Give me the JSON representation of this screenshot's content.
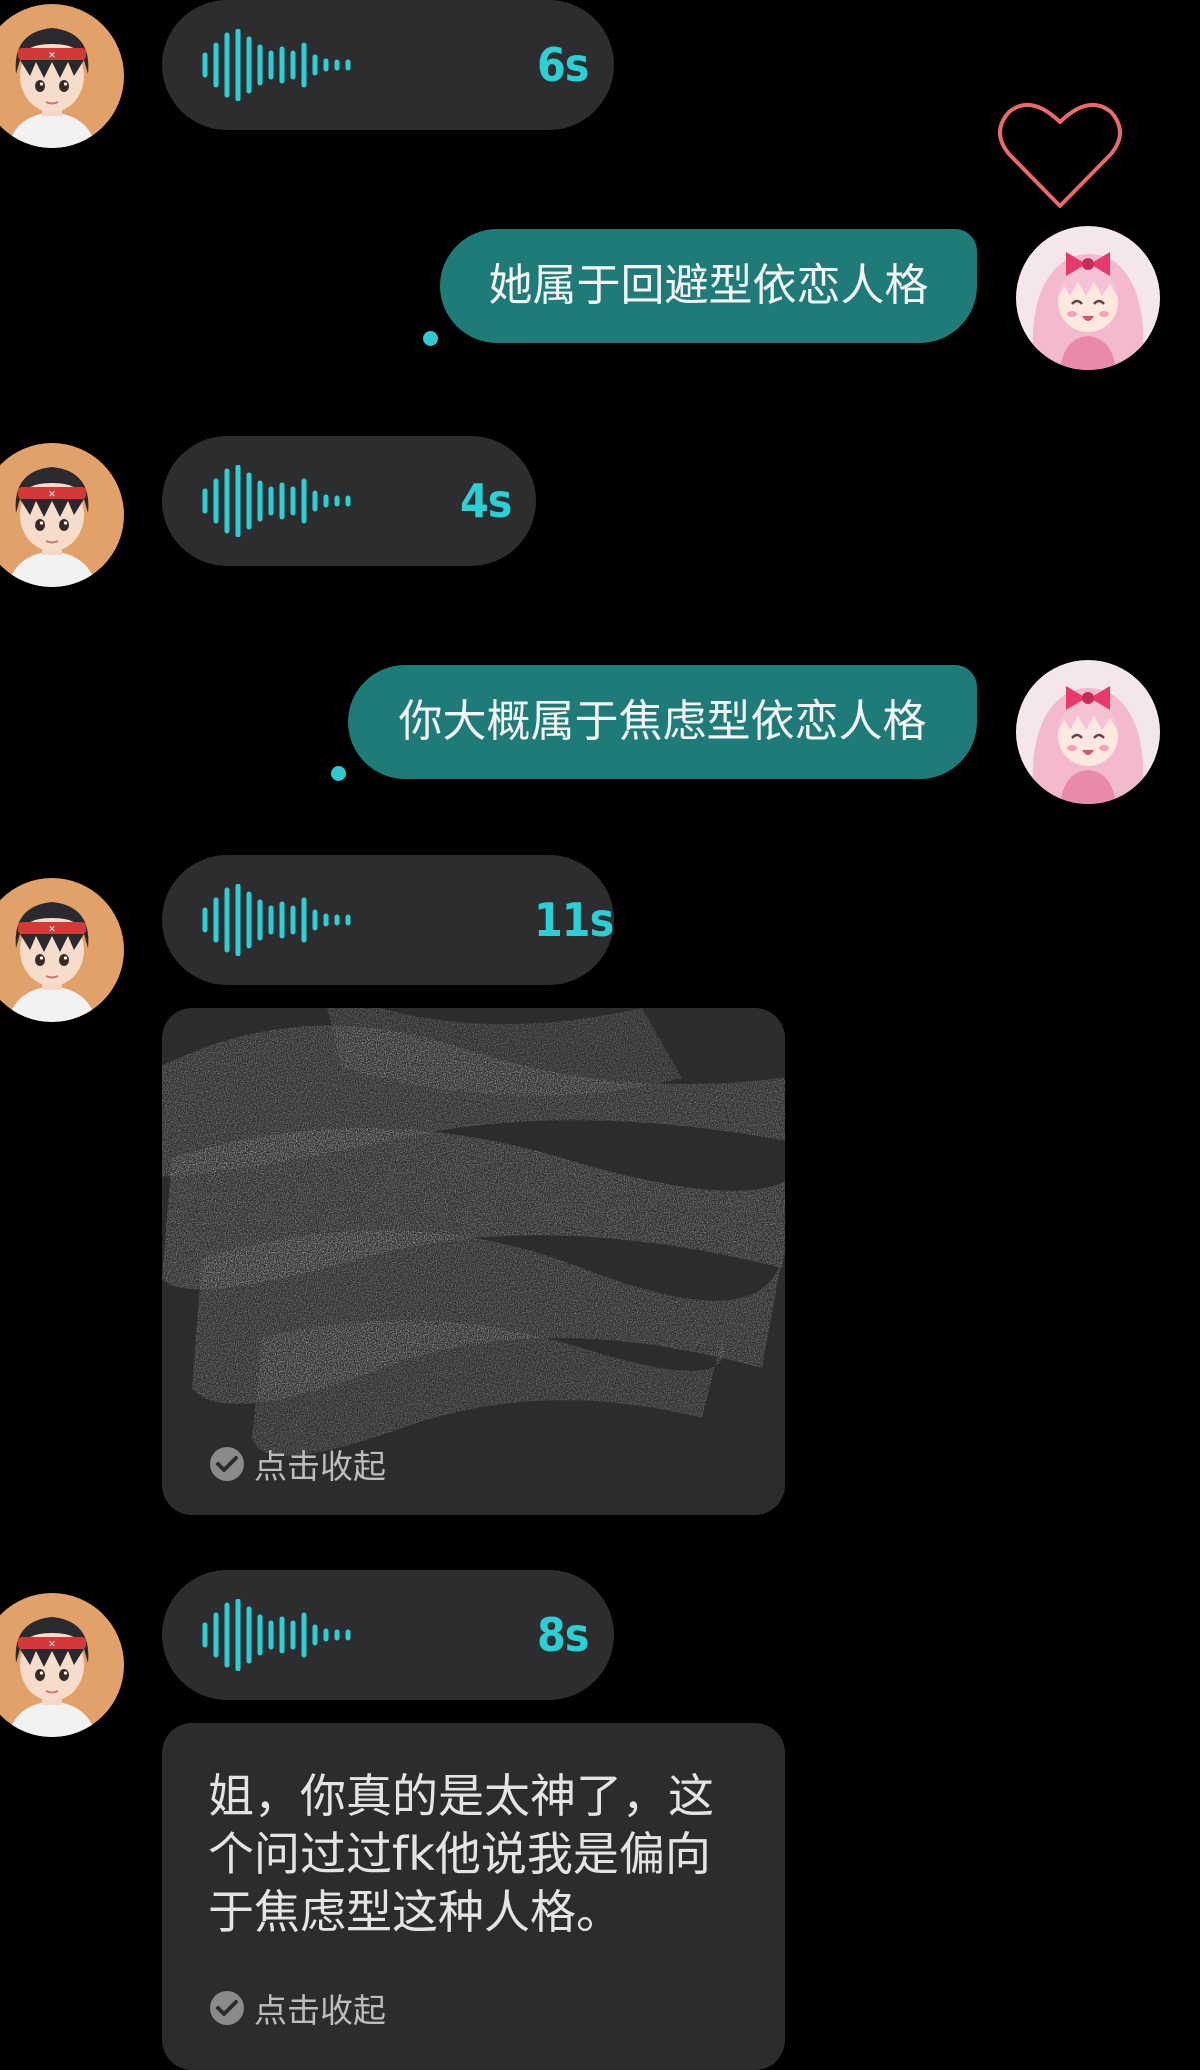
{
  "messages": [
    {
      "type": "voice",
      "side": "left",
      "duration": "6s"
    },
    {
      "type": "text",
      "side": "right",
      "text": "她属于回避型依恋人格"
    },
    {
      "type": "voice",
      "side": "left",
      "duration": "4s"
    },
    {
      "type": "text",
      "side": "right",
      "text": "你大概属于焦虑型依恋人格"
    },
    {
      "type": "voice",
      "side": "left",
      "duration": "11s"
    },
    {
      "type": "transcript",
      "side": "left",
      "text": "",
      "collapse_label": "点击收起",
      "redacted": true
    },
    {
      "type": "voice",
      "side": "left",
      "duration": "8s"
    },
    {
      "type": "transcript",
      "side": "left",
      "text": "姐，你真的是太神了，这个问过过fk他说我是偏向于焦虑型这种人格。",
      "collapse_label": "点击收起",
      "redacted": false
    }
  ],
  "icons": {
    "heart": "heart-outline-icon",
    "check": "check-circle-icon",
    "waveform": "voice-waveform-icon"
  },
  "colors": {
    "background": "#000000",
    "incoming_bubble": "#2d2d2f",
    "outgoing_bubble": "#1f7b78",
    "accent_cyan": "#29d0d6",
    "heart": "#e86a6a"
  }
}
